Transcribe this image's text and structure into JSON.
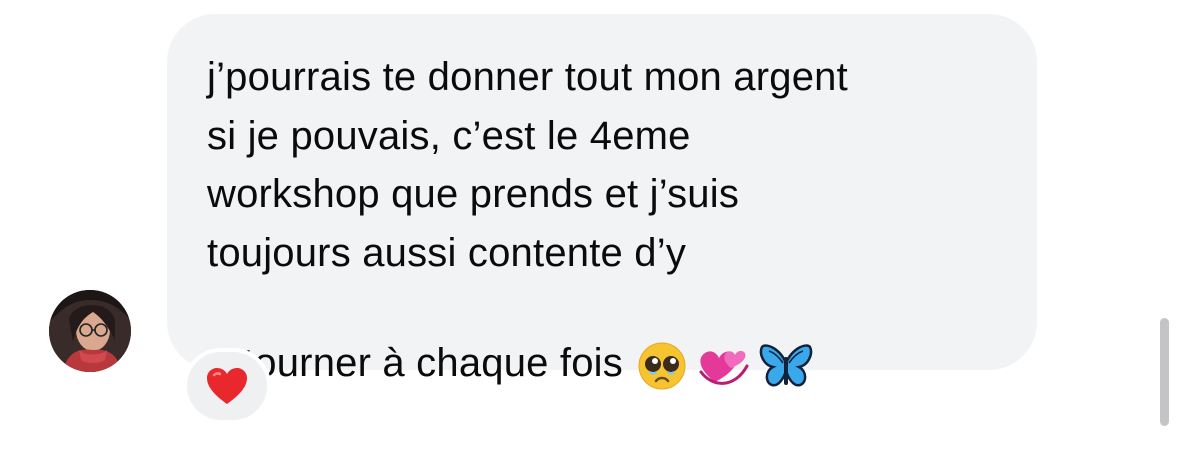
{
  "message": {
    "sender_avatar_icon": "user-avatar-photo",
    "text": "j’pourrais te donner tout mon argent\nsi je pouvais, c’est le 4eme\nworkshop que prends et j’suis\ntoujours aussi contente d’y\nretourner à chaque fois",
    "emojis": [
      "pleading-face-icon",
      "revolving-hearts-icon",
      "butterfly-icon"
    ],
    "bubble_color": "#f2f3f5",
    "text_color": "#0b0b0b"
  },
  "reaction": {
    "icon": "red-heart-icon",
    "color": "#e8282d"
  },
  "scrollbar": {
    "color": "#c4c4c6"
  }
}
